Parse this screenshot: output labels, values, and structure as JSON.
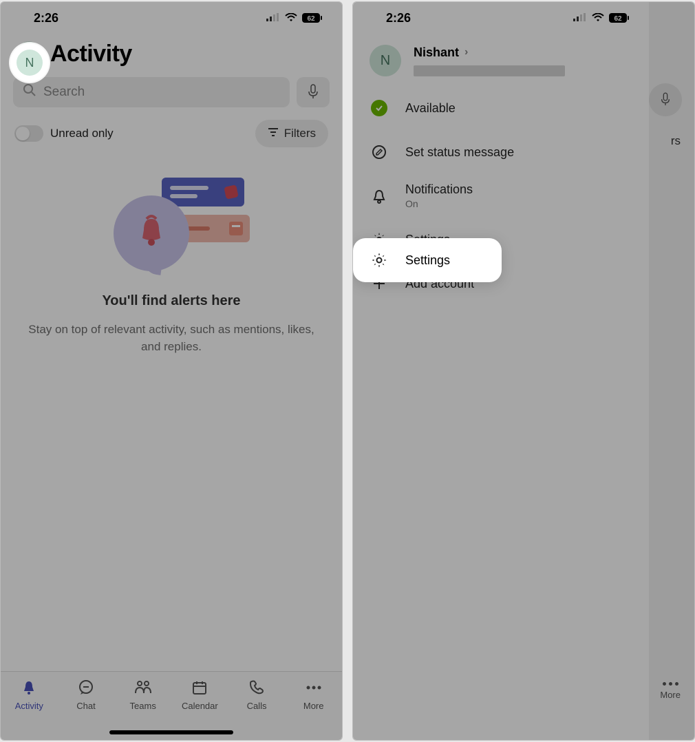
{
  "status_bar": {
    "time": "2:26",
    "battery": "62"
  },
  "left": {
    "avatar_initial": "N",
    "title": "Activity",
    "search_placeholder": "Search",
    "unread_only": "Unread only",
    "filters": "Filters",
    "empty_title": "You'll find alerts here",
    "empty_desc": "Stay on top of relevant activity, such as mentions, likes, and replies.",
    "tabs": {
      "activity": "Activity",
      "chat": "Chat",
      "teams": "Teams",
      "calendar": "Calendar",
      "calls": "Calls",
      "more": "More"
    }
  },
  "right": {
    "avatar_initial": "N",
    "user_name": "Nishant",
    "available": "Available",
    "set_status": "Set status message",
    "notifications": "Notifications",
    "notifications_state": "On",
    "settings": "Settings",
    "add_account": "Add account",
    "behind_filters": "rs",
    "behind_more": "More"
  }
}
